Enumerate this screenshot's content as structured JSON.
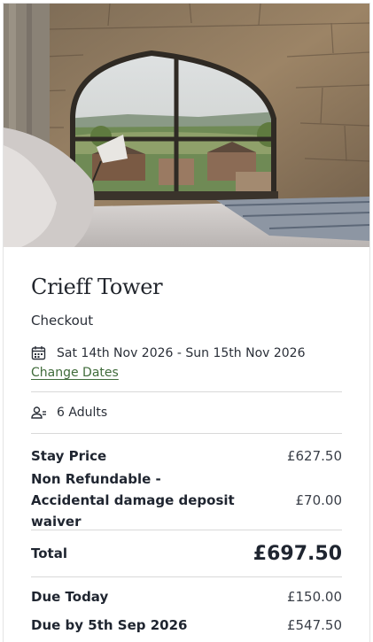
{
  "property": {
    "name": "Crieff Tower",
    "step": "Checkout"
  },
  "booking": {
    "dates": "Sat 14th Nov 2026 - Sun 15th Nov 2026",
    "change_dates_label": "Change Dates",
    "guests": "6 Adults"
  },
  "pricing": {
    "stay_price_label": "Stay Price",
    "stay_price_value": "£627.50",
    "deposit_label": "Non Refundable - Accidental damage deposit waiver",
    "deposit_value": "£70.00",
    "total_label": "Total",
    "total_value": "£697.50",
    "due_today_label": "Due Today",
    "due_today_value": "£150.00",
    "due_later_label": "Due by 5th Sep 2026",
    "due_later_value": "£547.50"
  },
  "icons": {
    "calendar": "calendar-icon",
    "guests": "guests-icon"
  },
  "colors": {
    "link": "#3f6b3a",
    "text": "#1f2530"
  }
}
